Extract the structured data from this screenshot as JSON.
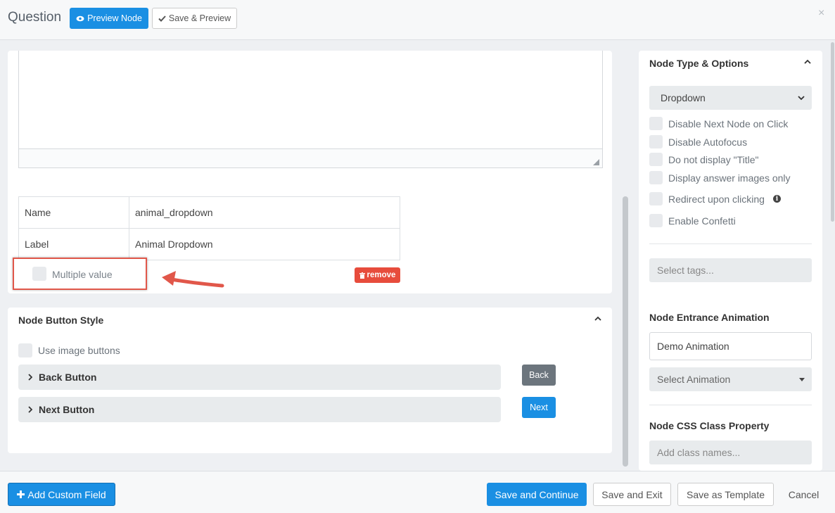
{
  "header": {
    "title": "Question",
    "preview_node_label": "Preview Node",
    "save_preview_label": "Save & Preview",
    "close_glyph": "×"
  },
  "fields_table": [
    {
      "key": "Name",
      "value": "animal_dropdown"
    },
    {
      "key": "Label",
      "value": "Animal Dropdown"
    }
  ],
  "multiple_value": {
    "label": "Multiple value",
    "checked": false
  },
  "remove_label": "remove",
  "node_button_style": {
    "title": "Node Button Style",
    "use_image_buttons": "Use image buttons",
    "back_accordion": "Back Button",
    "next_accordion": "Next Button",
    "back_preview": "Back",
    "next_preview": "Next"
  },
  "sidebar": {
    "title": "Node Type & Options",
    "node_type": "Dropdown",
    "options": [
      {
        "label": "Disable Next Node on Click"
      },
      {
        "label": "Disable Autofocus"
      },
      {
        "label": "Do not display \"Title\""
      },
      {
        "label": "Display answer images only"
      },
      {
        "label": "Redirect upon clicking"
      },
      {
        "label": "Enable Confetti"
      }
    ],
    "tags_placeholder": "Select tags...",
    "entrance_animation_label": "Node Entrance Animation",
    "demo_animation": "Demo Animation",
    "select_animation": "Select Animation",
    "css_class_label": "Node CSS Class Property",
    "css_class_placeholder": "Add class names..."
  },
  "footer": {
    "add_custom_field": "Add Custom Field",
    "save_continue": "Save and Continue",
    "save_exit": "Save and Exit",
    "save_template": "Save as Template",
    "cancel": "Cancel"
  },
  "colors": {
    "primary": "#1a8fe3",
    "danger": "#e74c3c",
    "secondary": "#6c757d",
    "highlight": "#e1574a"
  },
  "icons": [
    "eye-icon",
    "check-icon",
    "close-icon",
    "trash-icon",
    "chevron-up-icon",
    "chevron-right-icon",
    "chevron-down-icon",
    "info-icon",
    "plus-icon",
    "arrow-icon"
  ]
}
